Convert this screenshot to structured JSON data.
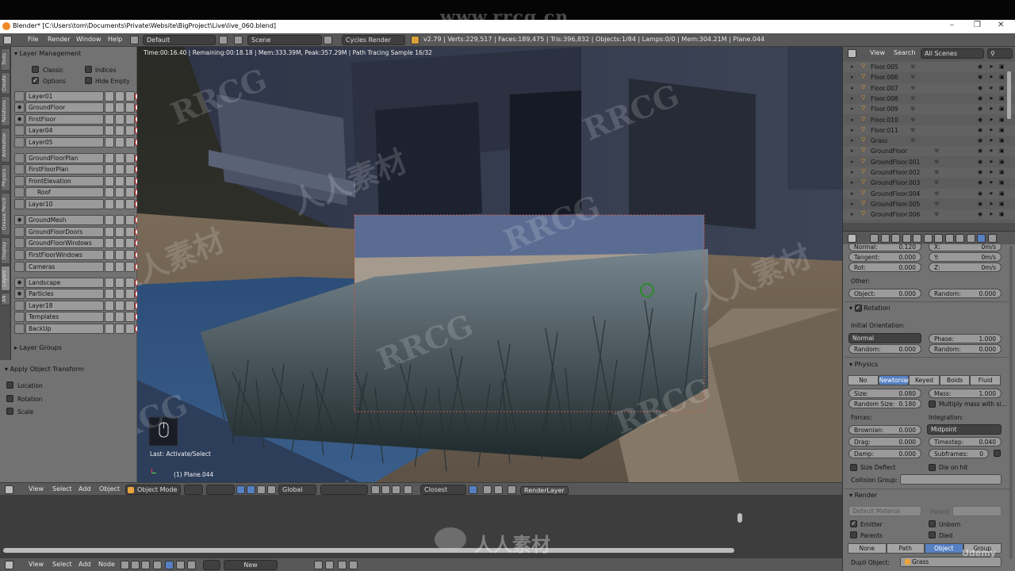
{
  "window": {
    "title": "Blender* [C:\\Users\\tom\\Documents\\Private\\Website\\BigProject\\Live\\live_060.blend]",
    "controls": [
      "–",
      "❒",
      "✕"
    ]
  },
  "watermarks": {
    "top": "www.rrcg.cn",
    "bottom_brand": "人人素材",
    "udemy": "Udemy",
    "tile_latin": "RRCG",
    "tile_cn": "人人素材"
  },
  "topbar": {
    "menu": [
      "File",
      "Render",
      "Window",
      "Help"
    ],
    "layout": "Default",
    "scene": "Scene",
    "engine": "Cycles Render",
    "stats": "v2.79 | Verts:229,517 | Faces:189,475 | Tris:396,832 | Objects:1/84 | Lamps:0/0 | Mem:304.21M | Plane.044"
  },
  "tool_tabs": [
    "Tools",
    "Create",
    "Relations",
    "Animation",
    "Physics",
    "Grease Pencil",
    "Display",
    "Layers",
    "AN"
  ],
  "layer_management": {
    "title": "Layer Management",
    "options": [
      {
        "label": "Classic",
        "checked": false
      },
      {
        "label": "Indices",
        "checked": false
      },
      {
        "label": "Options",
        "checked": true
      },
      {
        "label": "Hide Empty",
        "checked": false
      }
    ],
    "layers": [
      {
        "name": "Layer01",
        "visible": false
      },
      {
        "name": "GroundFloor",
        "visible": true
      },
      {
        "name": "FirstFloor",
        "visible": true
      },
      {
        "name": "Layer04",
        "visible": false
      },
      {
        "name": "Layer05",
        "visible": false
      },
      {
        "name": "GroundFloorPlan",
        "visible": false
      },
      {
        "name": "FirstFloorPlan",
        "visible": false
      },
      {
        "name": "FrontElevation",
        "visible": false
      },
      {
        "name": "Roof",
        "visible": false
      },
      {
        "name": "Layer10",
        "visible": false
      },
      {
        "name": "GroundMesh",
        "visible": true
      },
      {
        "name": "GroundFloorDoors",
        "visible": false
      },
      {
        "name": "GroundFloorWindows",
        "visible": false
      },
      {
        "name": "FirstFloorWindows",
        "visible": false
      },
      {
        "name": "Cameras",
        "visible": false
      },
      {
        "name": "Landscape",
        "visible": true
      },
      {
        "name": "Particles",
        "visible": true
      },
      {
        "name": "Layer18",
        "visible": false
      },
      {
        "name": "Templates",
        "visible": false
      },
      {
        "name": "BackUp",
        "visible": false
      }
    ],
    "layer_groups": "Layer Groups"
  },
  "apply_transform": {
    "title": "Apply Object Transform",
    "options": [
      {
        "label": "Location",
        "checked": false
      },
      {
        "label": "Rotation",
        "checked": false
      },
      {
        "label": "Scale",
        "checked": false
      }
    ]
  },
  "viewport": {
    "render_info": "Time:00:16.40 | Remaining:00:18.18 | Mem:333.39M, Peak:357.29M | Path Tracing Sample 16/32",
    "last_op": "Last: Activate/Select",
    "object_info": "(1) Plane.044"
  },
  "viewport_header": {
    "menu": [
      "View",
      "Select",
      "Add",
      "Object"
    ],
    "mode": "Object Mode",
    "orientation": "Global",
    "snap": "Closest",
    "render_layer": "RenderLayer"
  },
  "node_header": {
    "menu": [
      "View",
      "Select",
      "Add",
      "Node"
    ],
    "new_button": "New"
  },
  "outliner": {
    "menu": [
      "View",
      "Search"
    ],
    "filter": "All Scenes",
    "items": [
      "Floor.005",
      "Floor.006",
      "Floor.007",
      "Floor.008",
      "Floor.009",
      "Floor.010",
      "Floor.011",
      "Grass",
      "GroundFloor",
      "GroundFloor.001",
      "GroundFloor.002",
      "GroundFloor.003",
      "GroundFloor.004",
      "GroundFloor.005",
      "GroundFloor.006"
    ]
  },
  "properties": {
    "velocity": {
      "normal": {
        "label": "Normal:",
        "value": "0.120"
      },
      "tangent": {
        "label": "Tangent:",
        "value": "0.000"
      },
      "rot": {
        "label": "Rot:",
        "value": "0.000"
      },
      "x": {
        "label": "X:",
        "value": "0m/s"
      },
      "y": {
        "label": "Y:",
        "value": "0m/s"
      },
      "z": {
        "label": "Z:",
        "value": "0m/s"
      }
    },
    "other_label": "Other:",
    "object": {
      "label": "Object:",
      "value": "0.000"
    },
    "random": {
      "label": "Random:",
      "value": "0.000"
    },
    "rotation": {
      "title": "Rotation",
      "initial_orientation": "Initial Orientation:",
      "orientation_value": "Normal",
      "random": {
        "label": "Random:",
        "value": "0.000"
      },
      "phase": {
        "label": "Phase:",
        "value": "1.000"
      },
      "phase_random": {
        "label": "Random:",
        "value": "0.000"
      }
    },
    "physics": {
      "title": "Physics",
      "types": [
        "No",
        "Newtonian",
        "Keyed",
        "Boids",
        "Fluid"
      ],
      "active_type": "Newtonian",
      "size": {
        "label": "Size:",
        "value": "0.080"
      },
      "mass": {
        "label": "Mass:",
        "value": "1.000"
      },
      "random_size": {
        "label": "Random Size:",
        "value": "0.180"
      },
      "multiply_mass": "Multiply mass with si...",
      "forces_label": "Forces:",
      "integration_label": "Integration:",
      "brownian": {
        "label": "Brownian:",
        "value": "0.000"
      },
      "integration": "Midpoint",
      "drag": {
        "label": "Drag:",
        "value": "0.000"
      },
      "timestep": {
        "label": "Timestep:",
        "value": "0.040"
      },
      "damp": {
        "label": "Damp:",
        "value": "0.000"
      },
      "subframes": {
        "label": "Subframes:",
        "value": "0"
      },
      "size_deflect": "Size Deflect",
      "die_on_hit": "Die on hit",
      "collision_group": "Collision Group:"
    },
    "render": {
      "title": "Render",
      "material": "Default Material",
      "parent_label": "Parent:",
      "emitter": "Emitter",
      "unborn": "Unborn",
      "parents": "Parents",
      "died": "Died",
      "types": [
        "None",
        "Path",
        "Object",
        "Group"
      ],
      "active_type": "Object",
      "dupli_label": "Dupli Object:",
      "dupli_value": "Grass"
    }
  }
}
